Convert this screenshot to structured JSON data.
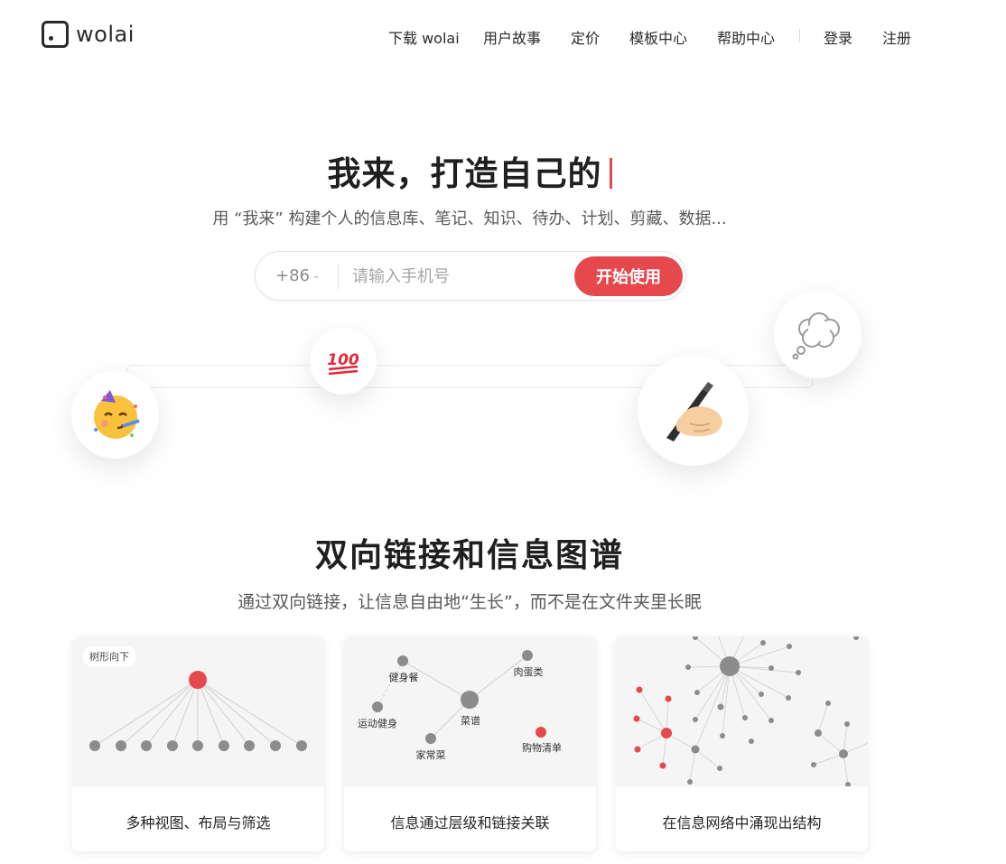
{
  "brand": {
    "name": "wolai"
  },
  "nav": {
    "items": [
      "下载 wolai",
      "用户故事",
      "定价",
      "模板中心",
      "帮助中心"
    ],
    "login": "登录",
    "register": "注册"
  },
  "hero": {
    "title": "我来，打造自己的",
    "subtitle": "用 “我来” 构建个人的信息库、笔记、知识、待办、计划、剪藏、数据...",
    "country_code": "+86",
    "phone_placeholder": "请输入手机号",
    "start_button": "开始使用"
  },
  "bubbles": [
    {
      "icon": "partying-face-emoji"
    },
    {
      "icon": "hundred-points-emoji"
    },
    {
      "icon": "writing-hand-emoji"
    },
    {
      "icon": "thought-balloon-emoji"
    }
  ],
  "section": {
    "title": "双向链接和信息图谱",
    "subtitle": "通过双向链接，让信息自由地“生长”，而不是在文件夹里长眠"
  },
  "cards": [
    {
      "tag": "树形向下",
      "caption": "多种视图、布局与筛选"
    },
    {
      "nodes": [
        "健身餐",
        "肉蛋类",
        "菜谱",
        "运动健身",
        "家常菜",
        "购物清单"
      ],
      "caption": "信息通过层级和链接关联"
    },
    {
      "caption": "在信息网络中涌现出结构"
    }
  ],
  "colors": {
    "accent": "#e5484d",
    "node": "#8c8c8c",
    "text": "#262626"
  }
}
